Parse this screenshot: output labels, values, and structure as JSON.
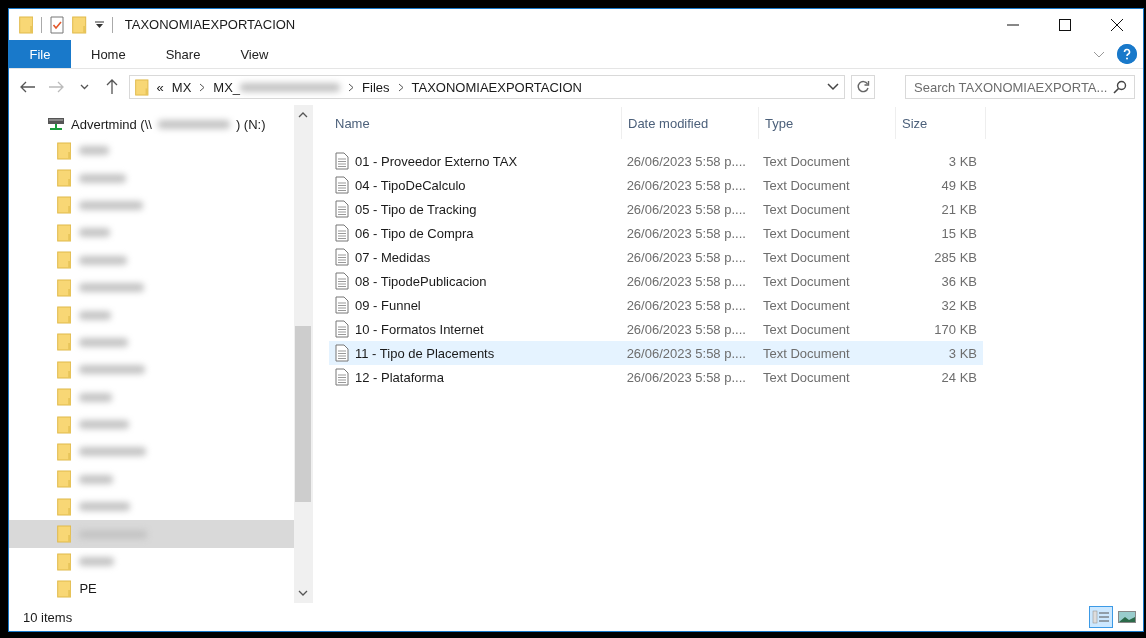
{
  "window": {
    "title": "TAXONOMIAEXPORTACION"
  },
  "ribbon": {
    "tabs": [
      {
        "label": "File",
        "selected": true
      },
      {
        "label": "Home",
        "selected": false
      },
      {
        "label": "Share",
        "selected": false
      },
      {
        "label": "View",
        "selected": false
      }
    ]
  },
  "address_bar": {
    "overflow": "«",
    "crumbs": [
      {
        "label": "MX",
        "blurred": false
      },
      {
        "label": "MX_",
        "blurred": true
      },
      {
        "label": "Files",
        "blurred": false
      },
      {
        "label": "TAXONOMIAEXPORTACION",
        "blurred": false
      }
    ]
  },
  "search": {
    "placeholder": "Search TAXONOMIAEXPORTA..."
  },
  "sidebar": {
    "drive": {
      "label_start": "Advertmind (\\\\",
      "label_end": ") (N:)"
    },
    "items": [
      {
        "kind": "blurred",
        "selected": false
      },
      {
        "kind": "blurred",
        "selected": false
      },
      {
        "kind": "blurred",
        "selected": false
      },
      {
        "kind": "blurred",
        "selected": false
      },
      {
        "kind": "blurred",
        "selected": false
      },
      {
        "kind": "blurred",
        "selected": false
      },
      {
        "kind": "blurred",
        "selected": false
      },
      {
        "kind": "blurred",
        "selected": false
      },
      {
        "kind": "blurred",
        "selected": false
      },
      {
        "kind": "blurred",
        "selected": false
      },
      {
        "kind": "blurred",
        "selected": false
      },
      {
        "kind": "blurred",
        "selected": false
      },
      {
        "kind": "blurred",
        "selected": false
      },
      {
        "kind": "blurred",
        "selected": false
      },
      {
        "kind": "blurred",
        "selected": true
      },
      {
        "kind": "blurred",
        "selected": false
      },
      {
        "kind": "folder",
        "label": "PE",
        "selected": false
      }
    ]
  },
  "table": {
    "columns": [
      "Name",
      "Date modified",
      "Type",
      "Size"
    ],
    "rows": [
      {
        "name": "01 - Proveedor Externo TAX",
        "date": "26/06/2023 5:58 p....",
        "type": "Text Document",
        "size": "3 KB",
        "selected": false
      },
      {
        "name": "04 - TipoDeCalculo",
        "date": "26/06/2023 5:58 p....",
        "type": "Text Document",
        "size": "49 KB",
        "selected": false
      },
      {
        "name": "05 - Tipo de Tracking",
        "date": "26/06/2023 5:58 p....",
        "type": "Text Document",
        "size": "21 KB",
        "selected": false
      },
      {
        "name": "06 - Tipo de Compra",
        "date": "26/06/2023 5:58 p....",
        "type": "Text Document",
        "size": "15 KB",
        "selected": false
      },
      {
        "name": "07 - Medidas",
        "date": "26/06/2023 5:58 p....",
        "type": "Text Document",
        "size": "285 KB",
        "selected": false
      },
      {
        "name": "08 - TipodePublicacion",
        "date": "26/06/2023 5:58 p....",
        "type": "Text Document",
        "size": "36 KB",
        "selected": false
      },
      {
        "name": "09 - Funnel",
        "date": "26/06/2023 5:58 p....",
        "type": "Text Document",
        "size": "32 KB",
        "selected": false
      },
      {
        "name": "10 - Formatos Internet",
        "date": "26/06/2023 5:58 p....",
        "type": "Text Document",
        "size": "170 KB",
        "selected": false
      },
      {
        "name": "11 - Tipo de Placements",
        "date": "26/06/2023 5:58 p....",
        "type": "Text Document",
        "size": "3 KB",
        "selected": true
      },
      {
        "name": "12 - Plataforma",
        "date": "26/06/2023 5:58 p....",
        "type": "Text Document",
        "size": "24 KB",
        "selected": false
      }
    ]
  },
  "status_bar": {
    "count": "10 items",
    "view_modes": [
      {
        "kind": "details",
        "selected": true
      },
      {
        "kind": "thumbnails",
        "selected": false
      }
    ]
  }
}
